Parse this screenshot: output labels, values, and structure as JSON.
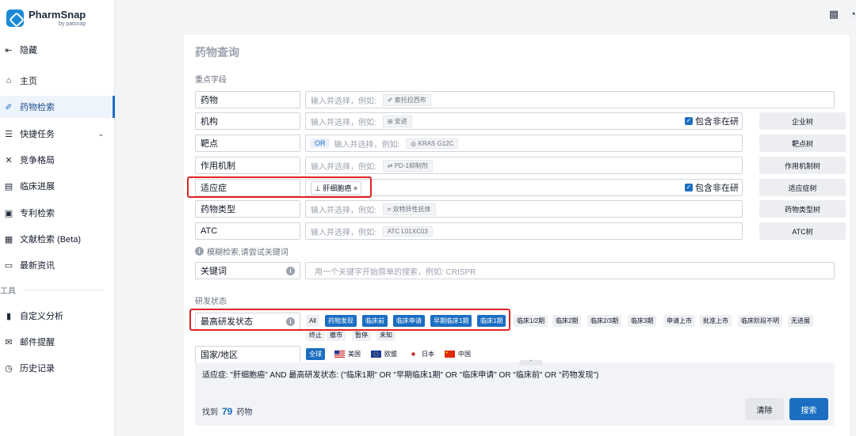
{
  "app": {
    "name": "PharmSnap",
    "by": "by patsnap"
  },
  "sidebar": {
    "collapse_label": "隐藏",
    "items": [
      {
        "label": "主页",
        "icon": "home-icon"
      },
      {
        "label": "药物检索",
        "icon": "pill-icon",
        "active": true
      },
      {
        "label": "快捷任务",
        "icon": "task-icon"
      },
      {
        "label": "竞争格局",
        "icon": "swords-icon"
      },
      {
        "label": "临床进展",
        "icon": "clinical-icon"
      },
      {
        "label": "专利检索",
        "icon": "patent-icon"
      },
      {
        "label": "文献检索 (Beta)",
        "icon": "literature-icon"
      },
      {
        "label": "最新资讯",
        "icon": "news-icon"
      }
    ],
    "tools_label": "工具",
    "tools": [
      {
        "label": "自定义分析",
        "icon": "analysis-icon"
      },
      {
        "label": "邮件提醒",
        "icon": "mail-icon"
      },
      {
        "label": "历史记录",
        "icon": "history-icon"
      }
    ]
  },
  "page": {
    "title": "药物查询",
    "key_fields_title": "重点字段",
    "rd_status_title": "研发状态"
  },
  "fields": {
    "drug": {
      "label": "药物",
      "placeholder": "输入并选择，例如:",
      "hint": "✐ 索托拉西布"
    },
    "org": {
      "label": "机构",
      "placeholder": "输入并选择，例如:",
      "hint": "⊞ 安进",
      "include_label": "包含非在研",
      "tree": "企业树"
    },
    "target": {
      "label": "靶点",
      "or": "OR",
      "placeholder": "输入并选择，例如:",
      "hint": "◎ KRAS G12C",
      "tree": "靶点树"
    },
    "moa": {
      "label": "作用机制",
      "placeholder": "输入并选择，例如:",
      "hint": "⇌ PD-1抑制剂",
      "tree": "作用机制树"
    },
    "indication": {
      "label": "适应症",
      "chip": "肝细胞癌",
      "include_label": "包含非在研",
      "tree": "适应症树"
    },
    "drug_type": {
      "label": "药物类型",
      "placeholder": "输入并选择，例如:",
      "hint": "⌗ 双特异性抗体",
      "tree": "药物类型树"
    },
    "atc": {
      "label": "ATC",
      "placeholder": "输入并选择，例如:",
      "hint": "ATC L01XC03",
      "tree": "ATC树"
    }
  },
  "fuzzy_hint": "模糊检索,请尝试关键词",
  "keyword": {
    "label": "关键词",
    "placeholder": "用一个关键字开始简单的搜索，例如:   CRISPR"
  },
  "status": {
    "label": "最高研发状态",
    "options": [
      "All",
      "药物发现",
      "临床前",
      "临床申请",
      "早期临床1期",
      "临床1期",
      "临床1/2期",
      "临床2期",
      "临床2/3期",
      "临床3期",
      "申请上市",
      "批准上市",
      "临床阶段不明",
      "无进展",
      "终止",
      "撤市",
      "暂停",
      "未知"
    ],
    "selected": [
      "药物发现",
      "临床前",
      "临床申请",
      "早期临床1期",
      "临床1期"
    ]
  },
  "region": {
    "label": "国家/地区",
    "options": [
      {
        "label": "全球",
        "selected": true
      },
      {
        "label": "美国",
        "flag": "us-flag-icon"
      },
      {
        "label": "欧盟",
        "flag": "eu-flag-icon"
      },
      {
        "label": "日本",
        "flag": "jp-flag-icon"
      },
      {
        "label": "中国",
        "flag": "cn-flag-icon"
      }
    ]
  },
  "query": {
    "text": "适应症: \"肝细胞癌\" AND 最高研发状态: (\"临床1期\" OR \"早期临床1期\" OR \"临床申请\" OR \"临床前\" OR \"药物发现\")",
    "found_prefix": "找到",
    "found_count": "79",
    "found_suffix": "药物",
    "clear": "清除",
    "search": "搜索"
  },
  "colors": {
    "accent": "#1b6ec2",
    "highlight": "#e02424"
  }
}
